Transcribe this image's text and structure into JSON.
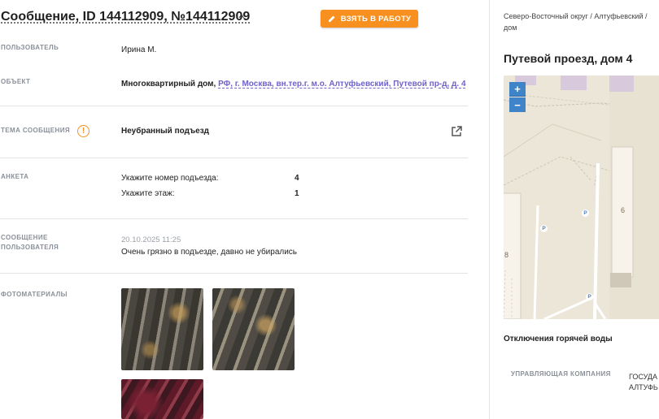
{
  "header": {
    "title": "Сообщение, ID 144112909, №144112909",
    "take_button": "ВЗЯТЬ В РАБОТУ"
  },
  "fields": {
    "user_label": "ПОЛЬЗОВАТЕЛЬ",
    "user_value": "Ирина М.",
    "object_label": "ОБЪЕКТ",
    "object_type": "Многоквартирный дом,",
    "object_address": "РФ, г. Москва, вн.тер.г. м.о. Алтуфьевский, Путевой пр-д, д. 4",
    "topic_label": "ТЕМА СООБЩЕНИЯ",
    "topic_value": "Неубранный подъезд",
    "survey_label": "АНКЕТА",
    "survey": [
      {
        "question": "Укажите номер подъезда:",
        "answer": "4"
      },
      {
        "question": "Укажите этаж:",
        "answer": "1"
      }
    ],
    "message_label_1": "СООБЩЕНИЕ",
    "message_label_2": "ПОЛЬЗОВАТЕЛЯ",
    "message_date": "20.10.2025 11:25",
    "message_text": "Очень грязно в подъезде, давно не убирались",
    "photos_label": "ФОТОМАТЕРИАЛЫ"
  },
  "sidebar": {
    "breadcrumb_1": "Северо-Восточный округ / Алтуфьевский /",
    "breadcrumb_2": "дом",
    "map_title": "Путевой проезд, дом 4",
    "map": {
      "zoom_in": "+",
      "zoom_out": "−",
      "parking": [
        "P",
        "P",
        "P"
      ],
      "building_numbers": [
        "6",
        "8"
      ]
    },
    "hot_water": "Отключения горячей воды",
    "mc_label": "УПРАВЛЯЮЩАЯ КОМПАНИЯ",
    "mc_value_1": "ГОСУДА",
    "mc_value_2": "АЛТУФЬ"
  },
  "colors": {
    "accent": "#f7901e",
    "link": "#6f62c9",
    "map_control": "#3f84c8"
  },
  "icons": [
    "chevron-up-icon",
    "pencil-icon",
    "warning-icon",
    "external-link-icon"
  ]
}
